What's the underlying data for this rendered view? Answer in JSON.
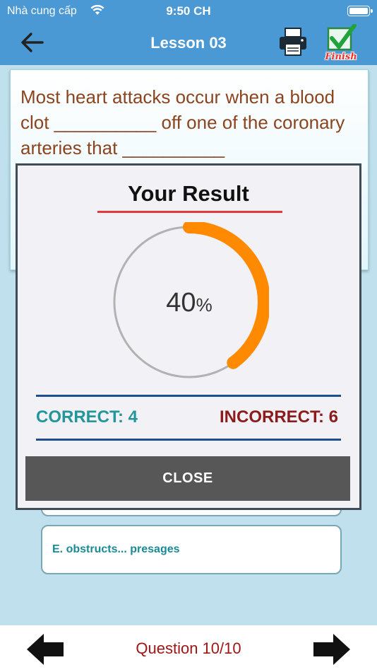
{
  "status_bar": {
    "carrier": "Nhà cung cấp",
    "time": "9:50 CH"
  },
  "nav": {
    "title": "Lesson 03",
    "finish_label": "Finish",
    "bar_color": "#4a98d4"
  },
  "question": {
    "text": "Most heart attacks occur when a blood clot __________ off one of the coronary arteries that __________"
  },
  "answers": [
    {
      "id": "E",
      "text": "E. obstructs... presages"
    }
  ],
  "result_modal": {
    "title": "Your Result",
    "percent": 40,
    "percent_sign": "%",
    "correct_label": "CORRECT: 4",
    "incorrect_label": "INCORRECT: 6",
    "close_label": "CLOSE",
    "progress_color": "#ff8a00",
    "correct_color": "#22969a",
    "incorrect_color": "#8c1c1c"
  },
  "footer": {
    "question_counter": "Question 10/10"
  },
  "icons": {
    "back": "arrow-left-icon",
    "print": "printer-icon",
    "finish": "checkbox-check-icon",
    "prev": "arrow-left-icon",
    "next": "arrow-right-icon"
  }
}
